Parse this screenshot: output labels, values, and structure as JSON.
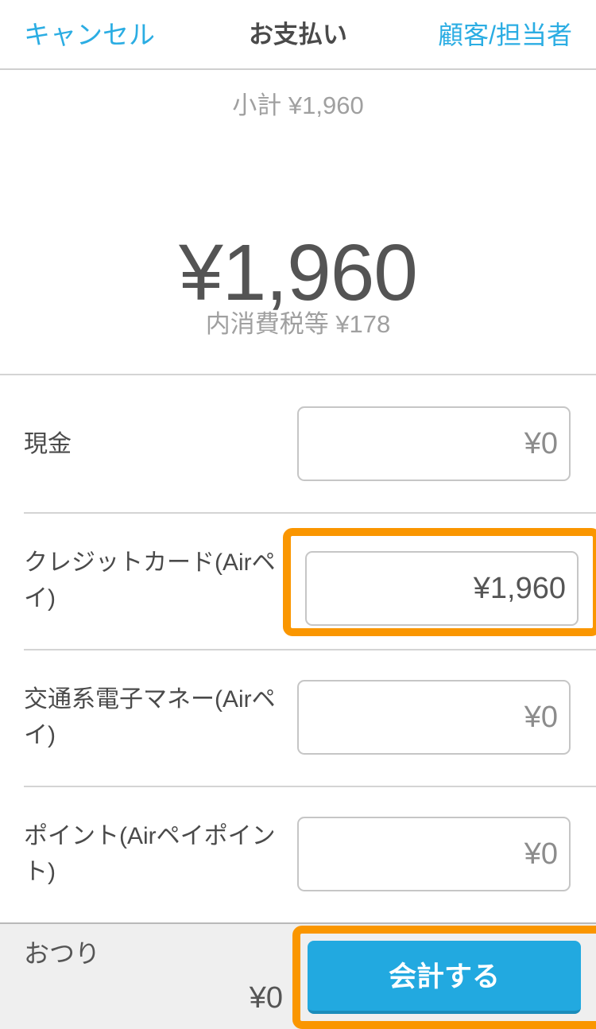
{
  "nav": {
    "cancel_label": "キャンセル",
    "title": "お支払い",
    "customer_label": "顧客/担当者"
  },
  "summary": {
    "subtotal_label": "小計",
    "subtotal_value": "¥1,960",
    "subtotal_line": "小計 ¥1,960",
    "grand_total": "¥1,960",
    "tax_label": "内消費税等",
    "tax_value": "¥178",
    "tax_line": "内消費税等 ¥178"
  },
  "payment_rows": [
    {
      "label": "現金",
      "value": "¥0",
      "highlighted": false
    },
    {
      "label": "クレジットカード(Airペイ)",
      "value": "¥1,960",
      "highlighted": true
    },
    {
      "label": "交通系電子マネー(Airペイ)",
      "value": "¥0",
      "highlighted": false
    },
    {
      "label": "ポイント(Airペイポイント)",
      "value": "¥0",
      "highlighted": false
    }
  ],
  "bottom": {
    "change_label": "おつり",
    "change_value": "¥0",
    "checkout_label": "会計する"
  },
  "colors": {
    "accent_blue": "#2badE3",
    "button_blue": "#22a9e0",
    "highlight_orange": "#fa9600",
    "text_dark": "#4a4a4a",
    "text_muted": "#a0a0a0",
    "bottom_bar_bg": "#efefef"
  }
}
